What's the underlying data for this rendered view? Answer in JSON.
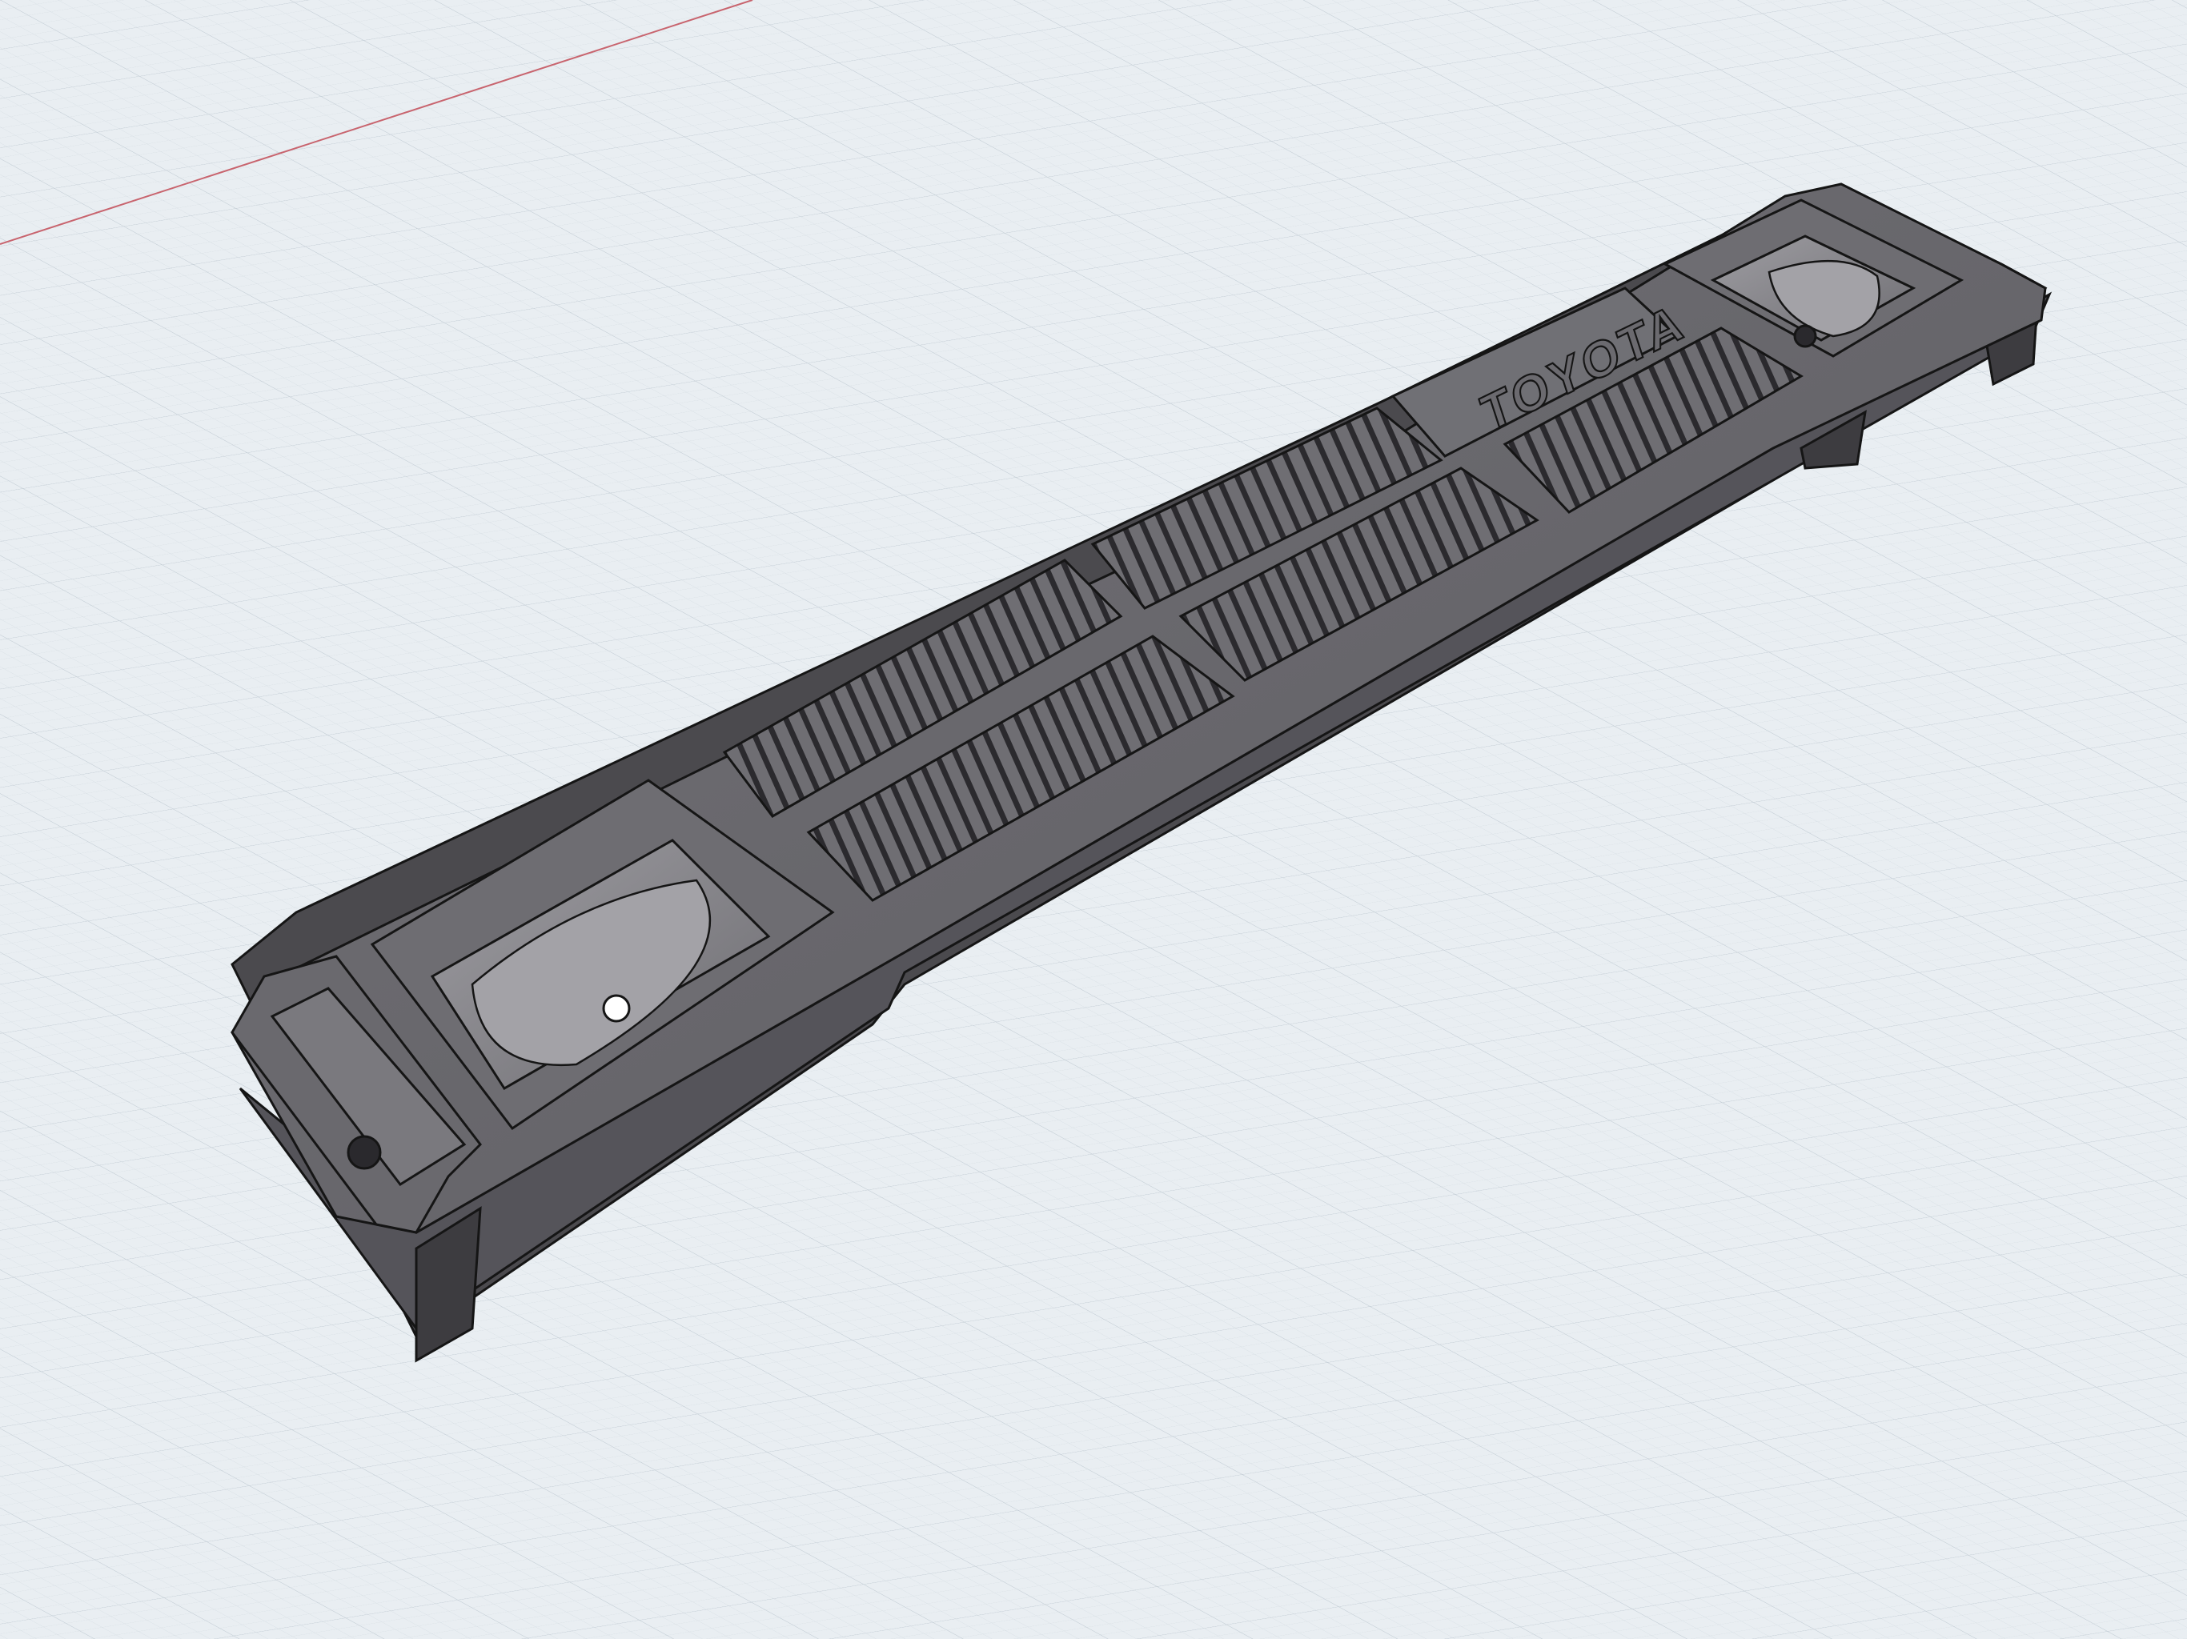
{
  "app": {
    "view": "3d-modeling-viewport"
  },
  "scene": {
    "background_color": "#e9eef2",
    "grid_minor_color": "#d3dbe1",
    "grid_major_color": "#c2ccd4",
    "axis_color": "#c8646e",
    "part_body_color": "#5f5e63",
    "part_top_color": "#6c6b70",
    "part_side_color": "#4b4a4e",
    "part_edge_color": "#151515",
    "pocket_color": "#747378",
    "cup_color": "#8b8a8f"
  },
  "model": {
    "name_visible": "",
    "emblem_text": "TOYOTA",
    "features": {
      "vent_pockets": 6,
      "mounting_cups": 2,
      "mounting_holes": 3
    }
  }
}
